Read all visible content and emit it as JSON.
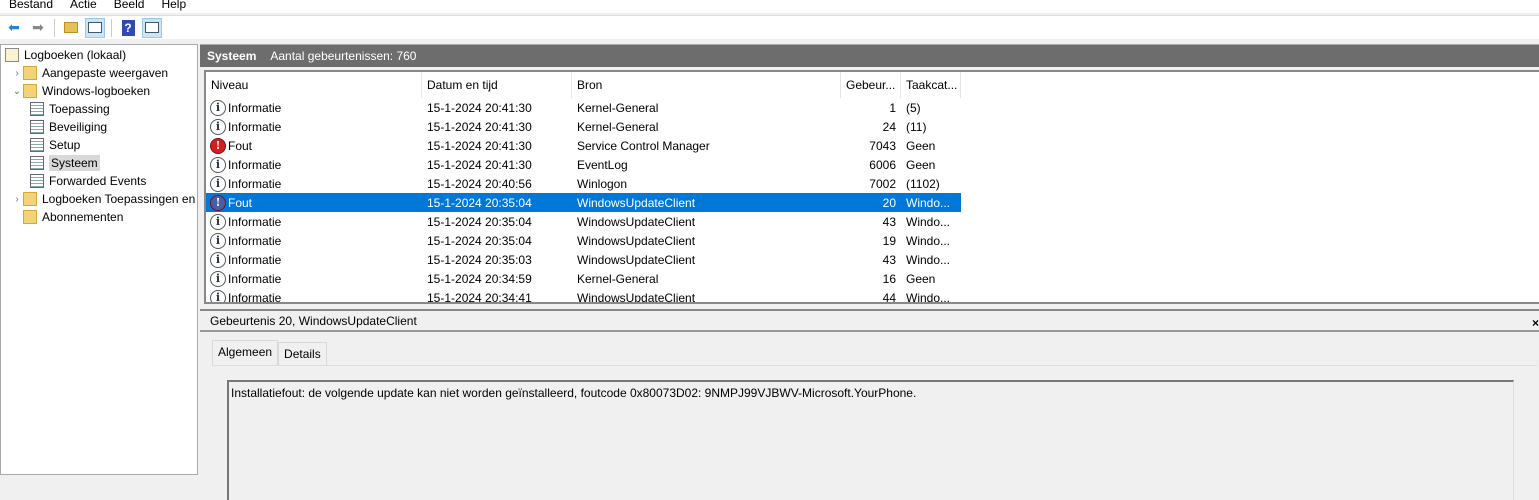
{
  "menu": [
    "Bestand",
    "Actie",
    "Beeld",
    "Help"
  ],
  "toolbar": {
    "icons": [
      "back-arrow-icon",
      "forward-arrow-icon",
      "up-folder-icon",
      "show-hide-console-tree-icon",
      "help-icon",
      "show-hide-action-pane-icon"
    ]
  },
  "tree": [
    {
      "label": "Logboeken (lokaal)",
      "level": 0,
      "expander": ""
    },
    {
      "label": "Aangepaste weergaven",
      "level": 1,
      "expander": ">"
    },
    {
      "label": "Windows-logboeken",
      "level": 1,
      "expander": "v"
    },
    {
      "label": "Toepassing",
      "level": 2,
      "expander": ""
    },
    {
      "label": "Beveiliging",
      "level": 2,
      "expander": ""
    },
    {
      "label": "Setup",
      "level": 2,
      "expander": ""
    },
    {
      "label": "Systeem",
      "level": 2,
      "expander": "",
      "selected": true
    },
    {
      "label": "Forwarded Events",
      "level": 2,
      "expander": ""
    },
    {
      "label": "Logboeken Toepassingen en",
      "level": 1,
      "expander": ">"
    },
    {
      "label": "Abonnementen",
      "level": 1,
      "expander": ""
    }
  ],
  "header": {
    "title": "Systeem",
    "count": "Aantal gebeurtenissen: 760"
  },
  "columns": [
    "Niveau",
    "Datum en tijd",
    "Bron",
    "Gebeur...",
    "Taakcat..."
  ],
  "rows": [
    {
      "level": "Informatie",
      "type": "info",
      "date": "15-1-2024 20:41:30",
      "source": "Kernel-General",
      "id": "1",
      "task": "(5)"
    },
    {
      "level": "Informatie",
      "type": "info",
      "date": "15-1-2024 20:41:30",
      "source": "Kernel-General",
      "id": "24",
      "task": "(11)"
    },
    {
      "level": "Fout",
      "type": "error",
      "date": "15-1-2024 20:41:30",
      "source": "Service Control Manager",
      "id": "7043",
      "task": "Geen"
    },
    {
      "level": "Informatie",
      "type": "info",
      "date": "15-1-2024 20:41:30",
      "source": "EventLog",
      "id": "6006",
      "task": "Geen"
    },
    {
      "level": "Informatie",
      "type": "info",
      "date": "15-1-2024 20:40:56",
      "source": "Winlogon",
      "id": "7002",
      "task": "(1102)"
    },
    {
      "level": "Fout",
      "type": "error",
      "date": "15-1-2024 20:35:04",
      "source": "WindowsUpdateClient",
      "id": "20",
      "task": "Windo...",
      "selected": true
    },
    {
      "level": "Informatie",
      "type": "info",
      "date": "15-1-2024 20:35:04",
      "source": "WindowsUpdateClient",
      "id": "43",
      "task": "Windo..."
    },
    {
      "level": "Informatie",
      "type": "info",
      "date": "15-1-2024 20:35:04",
      "source": "WindowsUpdateClient",
      "id": "19",
      "task": "Windo..."
    },
    {
      "level": "Informatie",
      "type": "info",
      "date": "15-1-2024 20:35:03",
      "source": "WindowsUpdateClient",
      "id": "43",
      "task": "Windo..."
    },
    {
      "level": "Informatie",
      "type": "info",
      "date": "15-1-2024 20:34:59",
      "source": "Kernel-General",
      "id": "16",
      "task": "Geen"
    },
    {
      "level": "Informatie",
      "type": "info",
      "date": "15-1-2024 20:34:41",
      "source": "WindowsUpdateClient",
      "id": "44",
      "task": "Windo..."
    }
  ],
  "detail": {
    "title": "Gebeurtenis 20, WindowsUpdateClient",
    "tabs": [
      "Algemeen",
      "Details"
    ],
    "message": "Installatiefout: de volgende update kan niet worden geïnstalleerd, foutcode 0x80073D02: 9NMPJ99VJBWV-Microsoft.YourPhone."
  }
}
